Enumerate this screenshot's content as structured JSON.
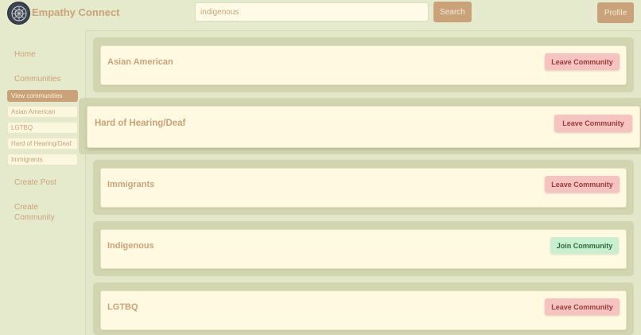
{
  "header": {
    "brand": "Empathy Connect",
    "search_value": "indigenous",
    "search_button": "Search",
    "profile_button": "Profile"
  },
  "sidebar": {
    "home": "Home",
    "communities": "Communities",
    "view_communities": "View communities",
    "joined": [
      "Asian American",
      "LGTBQ",
      "Hard of Hearing/Deaf",
      "Immigrants"
    ],
    "create_post": "Create Post",
    "create_community": "Create Community"
  },
  "communities": [
    {
      "name": "Asian American",
      "action": "Leave Community"
    },
    {
      "name": "Hard of Hearing/Deaf",
      "action": "Leave Community"
    },
    {
      "name": "Immigrants",
      "action": "Leave Community"
    },
    {
      "name": "Indigenous",
      "action": "Join Community"
    },
    {
      "name": "LGTBQ",
      "action": "Leave Community"
    }
  ]
}
